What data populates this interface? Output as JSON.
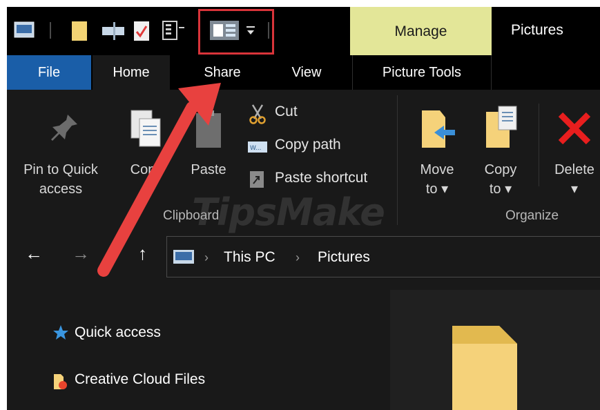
{
  "titlebar": {
    "contextual_tab": "Manage",
    "window_title": "Pictures"
  },
  "tabs": {
    "file": "File",
    "home": "Home",
    "share": "Share",
    "view": "View",
    "picture_tools": "Picture Tools"
  },
  "ribbon": {
    "pin": [
      "Pin to Quick",
      "access"
    ],
    "copy": "Copy",
    "paste": "Paste",
    "cut": "Cut",
    "copy_path": "Copy path",
    "paste_shortcut": "Paste shortcut",
    "clipboard_group": "Clipboard",
    "move_to": [
      "Move",
      "to ▾"
    ],
    "copy_to": [
      "Copy",
      "to ▾"
    ],
    "delete": [
      "Delete",
      "▾"
    ],
    "organize_group": "Organize"
  },
  "address": {
    "crumbs": [
      "This PC",
      "Pictures"
    ]
  },
  "navpane": {
    "items": [
      "Quick access",
      "Creative Cloud Files"
    ]
  },
  "watermark": "TipsMake",
  "colors": {
    "file_tab": "#1a5ea8",
    "manage_bg": "#e3e698",
    "highlight": "#d9343a",
    "folder": "#f5d27a"
  }
}
